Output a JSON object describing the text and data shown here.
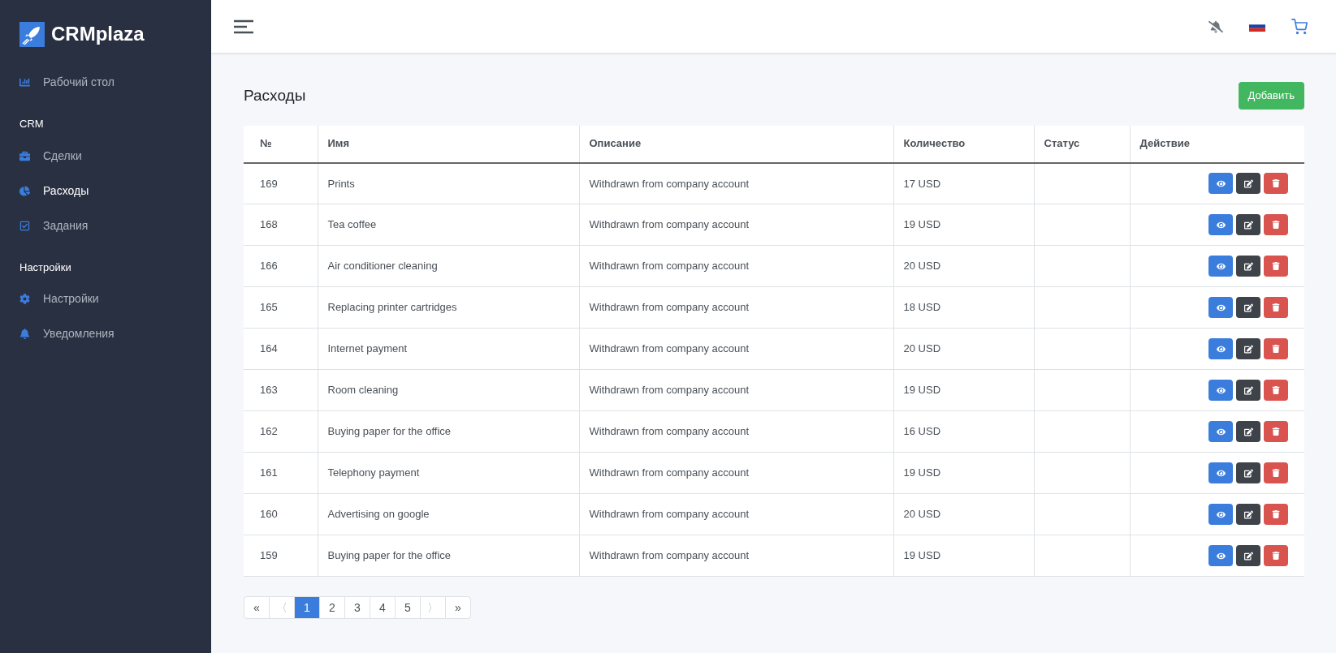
{
  "brand": {
    "name": "CRMplaza"
  },
  "sidebar": {
    "sections": [
      {
        "items": [
          {
            "label": "Рабочий стол",
            "selected": false
          }
        ]
      },
      {
        "heading": "CRM",
        "items": [
          {
            "label": "Сделки",
            "selected": false
          },
          {
            "label": "Расходы",
            "selected": true
          },
          {
            "label": "Задания",
            "selected": false
          }
        ]
      },
      {
        "heading": "Настройки",
        "items": [
          {
            "label": "Настройки",
            "selected": false
          },
          {
            "label": "Уведомления",
            "selected": false
          }
        ]
      }
    ]
  },
  "page": {
    "title": "Расходы",
    "add_button": "Добавить"
  },
  "table": {
    "columns": [
      "№",
      "Имя",
      "Описание",
      "Количество",
      "Статус",
      "Действие"
    ],
    "rows": [
      {
        "id": "169",
        "name": "Prints",
        "description": "Withdrawn from company account",
        "amount": "17 USD"
      },
      {
        "id": "168",
        "name": "Tea coffee",
        "description": "Withdrawn from company account",
        "amount": "19 USD"
      },
      {
        "id": "166",
        "name": "Air conditioner cleaning",
        "description": "Withdrawn from company account",
        "amount": "20 USD"
      },
      {
        "id": "165",
        "name": "Replacing printer cartridges",
        "description": "Withdrawn from company account",
        "amount": "18 USD"
      },
      {
        "id": "164",
        "name": "Internet payment",
        "description": "Withdrawn from company account",
        "amount": "20 USD"
      },
      {
        "id": "163",
        "name": "Room cleaning",
        "description": "Withdrawn from company account",
        "amount": "19 USD"
      },
      {
        "id": "162",
        "name": "Buying paper for the office",
        "description": "Withdrawn from company account",
        "amount": "16 USD"
      },
      {
        "id": "161",
        "name": "Telephony payment",
        "description": "Withdrawn from company account",
        "amount": "19 USD"
      },
      {
        "id": "160",
        "name": "Advertising on google",
        "description": "Withdrawn from company account",
        "amount": "20 USD"
      },
      {
        "id": "159",
        "name": "Buying paper for the office",
        "description": "Withdrawn from company account",
        "amount": "19 USD"
      }
    ]
  },
  "pagination": [
    {
      "label": "«",
      "selected": false,
      "disabled": false
    },
    {
      "label": "〈",
      "selected": false,
      "disabled": true
    },
    {
      "label": "1",
      "selected": true,
      "disabled": false
    },
    {
      "label": "2",
      "selected": false,
      "disabled": false
    },
    {
      "label": "3",
      "selected": false,
      "disabled": false
    },
    {
      "label": "4",
      "selected": false,
      "disabled": false
    },
    {
      "label": "5",
      "selected": false,
      "disabled": false
    },
    {
      "label": "〉",
      "selected": false,
      "disabled": true
    },
    {
      "label": "»",
      "selected": false,
      "disabled": false
    }
  ]
}
